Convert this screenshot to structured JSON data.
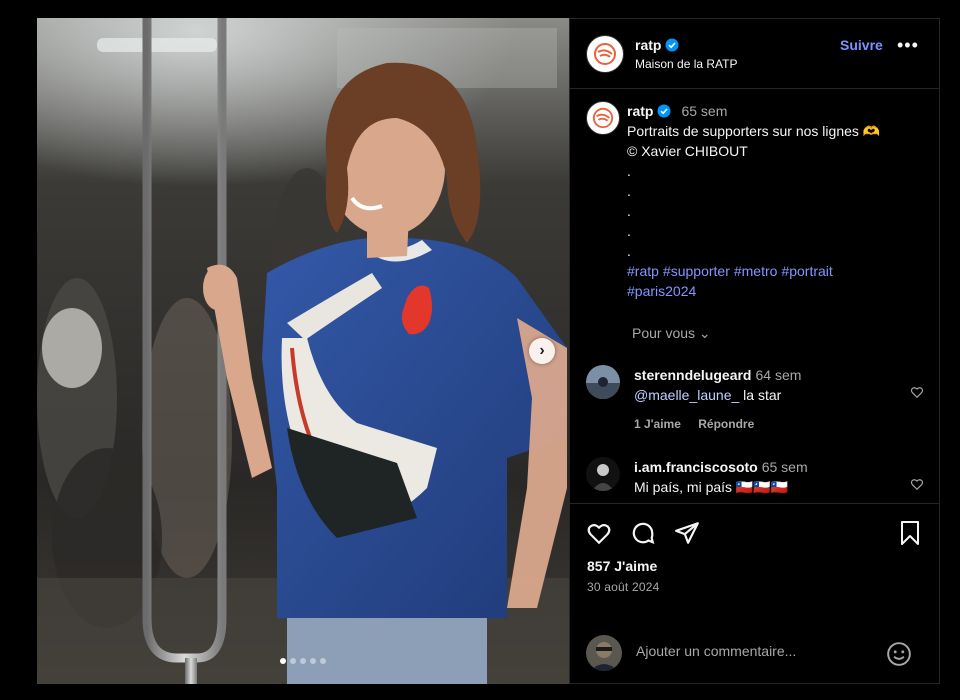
{
  "post": {
    "username": "ratp",
    "subtitle": "Maison de la RATP",
    "follow_label": "Suivre",
    "more_label": "•••",
    "caption_time": "65 sem",
    "caption_lines": [
      "Portraits de supporters sur nos lignes 🫶",
      "© Xavier CHIBOUT",
      ".",
      ".",
      ".",
      ".",
      "."
    ],
    "hashtags_line1": [
      "#ratp",
      "#supporter",
      "#metro",
      "#portrait"
    ],
    "hashtags_line2": [
      "#paris2024"
    ],
    "translate_label": "Pour vous ⌄",
    "likes": "857 J'aime",
    "date": "30 août 2024",
    "carousel": {
      "slides": 5,
      "active_slide": 1
    }
  },
  "comments": [
    {
      "user": "sterenndelugeard",
      "time": "64 sem",
      "mention": "@maelle_laune_",
      "text": "la star",
      "likes_label": "1 J'aime",
      "reply_label": "Répondre"
    },
    {
      "user": "i.am.franciscosoto",
      "time": "65 sem",
      "text": "Mi país, mi país 🇨🇱🇨🇱🇨🇱"
    }
  ],
  "add_comment": {
    "placeholder": "Ajouter un commentaire..."
  },
  "colors": {
    "background": "#000000",
    "text": "#f5f5f5",
    "muted": "#a8a8a8",
    "link": "#8396ff",
    "verified": "#0095f6",
    "border": "#262626",
    "logo_orange": "#e8623c"
  },
  "icons": [
    "verified-badge-icon",
    "more-icon",
    "chevron-right-icon",
    "heart-icon",
    "comment-icon",
    "share-icon",
    "bookmark-icon",
    "emoji-icon"
  ]
}
